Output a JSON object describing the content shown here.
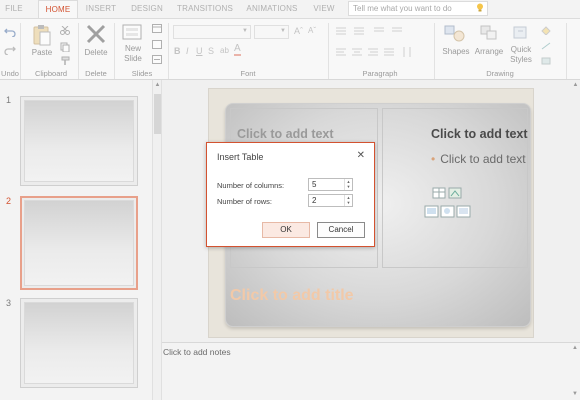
{
  "tabs": [
    {
      "label": "FILE",
      "active": false
    },
    {
      "label": "HOME",
      "active": true
    },
    {
      "label": "INSERT",
      "active": false
    },
    {
      "label": "DESIGN",
      "active": false
    },
    {
      "label": "TRANSITIONS",
      "active": false
    },
    {
      "label": "ANIMATIONS",
      "active": false
    },
    {
      "label": "VIEW",
      "active": false
    }
  ],
  "tell_me": {
    "placeholder": "Tell me what you want to do"
  },
  "ribbon": {
    "clipboard": {
      "paste_label": "Paste",
      "group_label": "Clipboard"
    },
    "delete": {
      "delete_label": "Delete",
      "group_label": "Delete"
    },
    "slides": {
      "new_slide_label": "New Slide",
      "group_label": "Slides"
    },
    "undo": {
      "group_label": "Undo"
    },
    "font": {
      "group_label": "Font",
      "font_name": "",
      "font_size": ""
    },
    "paragraph": {
      "group_label": "Paragraph"
    },
    "drawing": {
      "shapes_label": "Shapes",
      "arrange_label": "Arrange",
      "quick_styles_label": "Quick Styles",
      "group_label": "Drawing"
    }
  },
  "thumbnails": [
    {
      "number": "1",
      "selected": false
    },
    {
      "number": "2",
      "selected": true
    },
    {
      "number": "3",
      "selected": false
    }
  ],
  "slide": {
    "left_placeholder": "Click to add text",
    "right_placeholder_title": "Click to add text",
    "right_placeholder_bullet": "Click to add text",
    "title_placeholder": "Click to add title"
  },
  "notes": {
    "placeholder": "Click to add notes"
  },
  "dialog": {
    "title": "Insert Table",
    "columns_label": "Number of columns:",
    "columns_value": "5",
    "rows_label": "Number of rows:",
    "rows_value": "2",
    "ok_label": "OK",
    "cancel_label": "Cancel"
  },
  "colors": {
    "accent": "#d35230",
    "title_placeholder": "#f2c9a8",
    "bullet": "#d9a37a"
  }
}
